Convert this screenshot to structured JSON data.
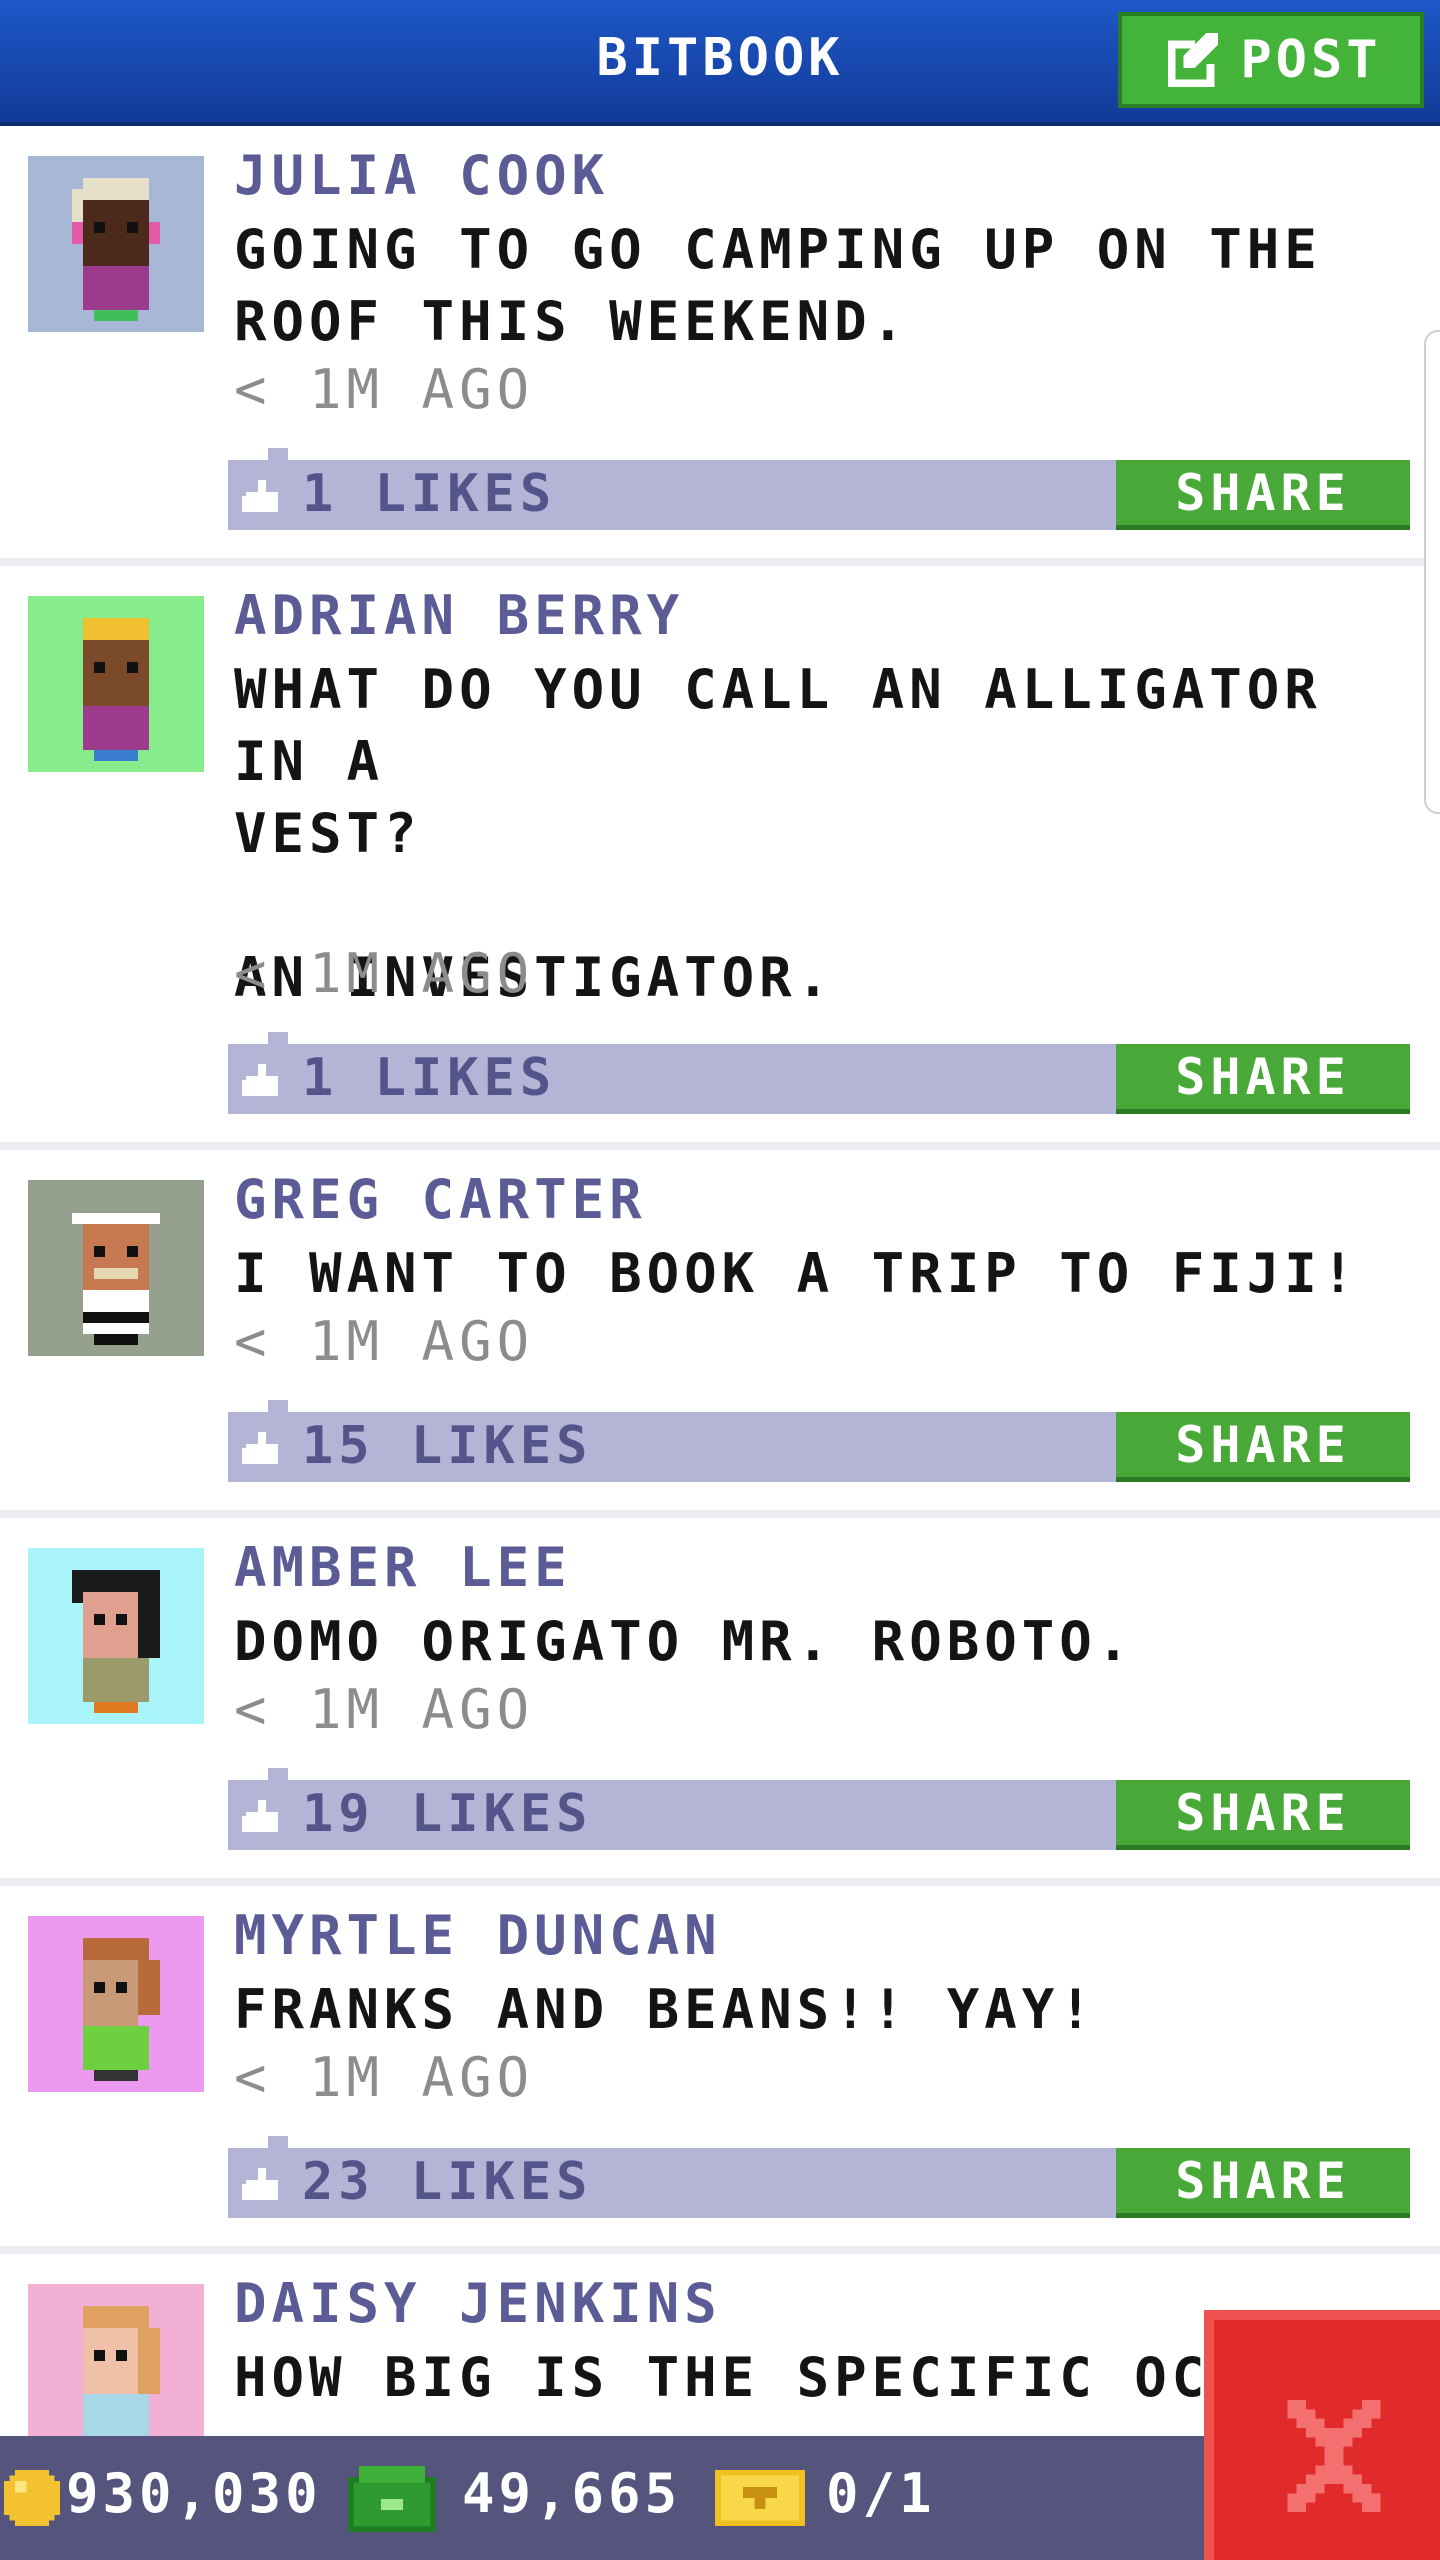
{
  "header": {
    "title": "BITBOOK",
    "post_label": "POST"
  },
  "colors": {
    "header_blue": "#1a4fc0",
    "accent_green": "#48a838",
    "like_bar": "#b4b4d6",
    "name_purple": "#5b5b96",
    "status_bar": "#54547c",
    "close_red": "#e12a2a"
  },
  "feed": {
    "posts": [
      {
        "author": "JULIA COOK",
        "text": "GOING TO GO CAMPING UP ON THE\nROOF THIS WEEKEND.",
        "time": "< 1M AGO",
        "likes": "1 LIKES",
        "share_label": "SHARE",
        "avatar_bg": "#a9b7d6"
      },
      {
        "author": "ADRIAN BERRY",
        "text": "WHAT DO YOU CALL AN ALLIGATOR IN A\nVEST?\n\nAN INVESTIGATOR.",
        "time": "< 1M AGO",
        "likes": "1 LIKES",
        "share_label": "SHARE",
        "avatar_bg": "#86ec8c"
      },
      {
        "author": "GREG CARTER",
        "text": "I WANT TO BOOK A TRIP TO FIJI!",
        "time": "< 1M AGO",
        "likes": "15 LIKES",
        "share_label": "SHARE",
        "avatar_bg": "#95a18d"
      },
      {
        "author": "AMBER LEE",
        "text": "DOMO ORIGATO MR. ROBOTO.",
        "time": "< 1M AGO",
        "likes": "19 LIKES",
        "share_label": "SHARE",
        "avatar_bg": "#a8f4f8"
      },
      {
        "author": "MYRTLE DUNCAN",
        "text": "FRANKS AND BEANS!! YAY!",
        "time": "< 1M AGO",
        "likes": "23 LIKES",
        "share_label": "SHARE",
        "avatar_bg": "#ec9af0"
      },
      {
        "author": "DAISY JENKINS",
        "text": "HOW BIG IS THE SPECIFIC OCEAN?",
        "avatar_bg": "#f2b0d6"
      }
    ]
  },
  "status": {
    "coins": "930,030",
    "bux": "49,665",
    "tickets": "0/1"
  },
  "icons": {
    "post": "edit-icon",
    "like": "thumbs-up-icon",
    "coin": "coin-icon",
    "cash": "cash-icon",
    "ticket": "ticket-icon",
    "close": "close-icon"
  }
}
